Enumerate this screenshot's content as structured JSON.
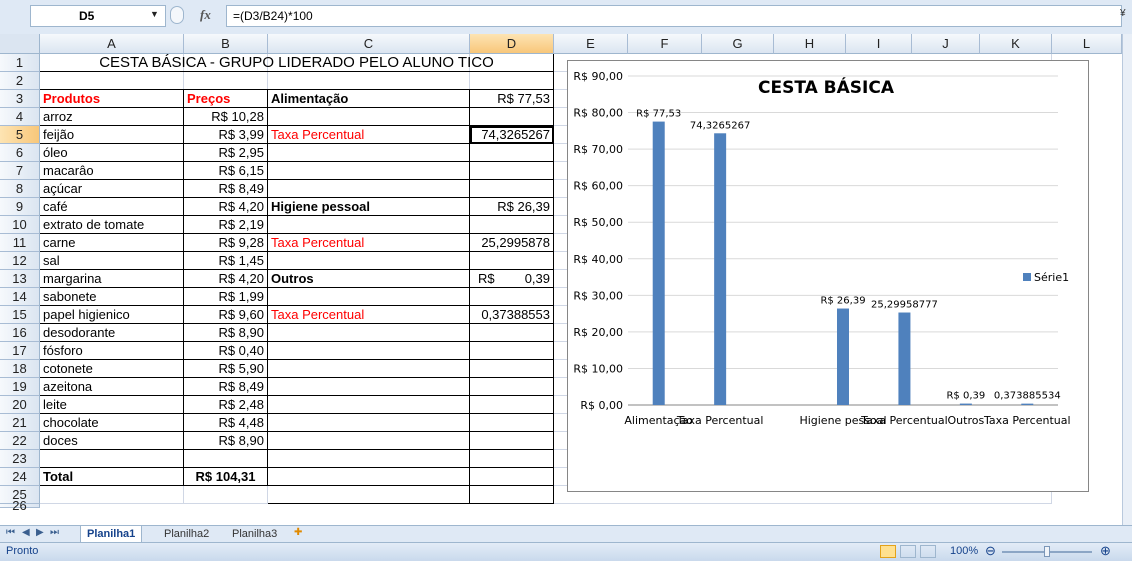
{
  "formula_bar": {
    "name_box": "D5",
    "fx": "fx",
    "formula": "=(D3/B24)*100"
  },
  "columns": [
    "A",
    "B",
    "C",
    "D",
    "E",
    "F",
    "G",
    "H",
    "I",
    "J",
    "K",
    "L"
  ],
  "rows": [
    "1",
    "2",
    "3",
    "4",
    "5",
    "6",
    "7",
    "8",
    "9",
    "10",
    "11",
    "12",
    "13",
    "14",
    "15",
    "16",
    "17",
    "18",
    "19",
    "20",
    "21",
    "22",
    "23",
    "24",
    "25",
    "26"
  ],
  "sheet": {
    "title": "CESTA BÁSICA - GRUPO LIDERADO PELO ALUNO TICO",
    "header_products": "Produtos",
    "header_prices": "Preços",
    "items": [
      {
        "name": "arroz",
        "price": "R$ 10,28"
      },
      {
        "name": "feijão",
        "price": "R$ 3,99"
      },
      {
        "name": "óleo",
        "price": "R$ 2,95"
      },
      {
        "name": "macarâo",
        "price": "R$ 6,15"
      },
      {
        "name": "açúcar",
        "price": "R$ 8,49"
      },
      {
        "name": "café",
        "price": "R$ 4,20"
      },
      {
        "name": "extrato de tomate",
        "price": "R$ 2,19"
      },
      {
        "name": "carne",
        "price": "R$ 9,28"
      },
      {
        "name": "sal",
        "price": "R$ 1,45"
      },
      {
        "name": "margarina",
        "price": "R$ 4,20"
      },
      {
        "name": "sabonete",
        "price": "R$ 1,99"
      },
      {
        "name": "papel higienico",
        "price": "R$ 9,60"
      },
      {
        "name": "desodorante",
        "price": "R$ 8,90"
      },
      {
        "name": "fósforo",
        "price": "R$ 0,40"
      },
      {
        "name": "cotonete",
        "price": "R$ 5,90"
      },
      {
        "name": "azeitona",
        "price": "R$ 8,49"
      },
      {
        "name": "leite",
        "price": "R$ 2,48"
      },
      {
        "name": "chocolate",
        "price": "R$ 4,48"
      },
      {
        "name": "doces",
        "price": "R$ 8,90"
      }
    ],
    "total_label": "Total",
    "total_value": "R$ 104,31",
    "cat_alimentacao": "Alimentação",
    "val_alimentacao": "R$ 77,53",
    "taxa_label": "Taxa Percentual",
    "taxa_alimentacao": "74,3265267",
    "cat_higiene": "Higiene  pessoal",
    "val_higiene": "R$ 26,39",
    "taxa_higiene": "25,2995878",
    "cat_outros": "Outros",
    "val_outros_currency": "R$",
    "val_outros_number": "0,39",
    "taxa_outros": "0,37388553"
  },
  "chart_data": {
    "type": "bar",
    "title": "CESTA BÁSICA",
    "categories": [
      "Alimentação",
      "Taxa Percentual",
      "",
      "Higiene  pessoal",
      "Taxa Percentual",
      "Outros",
      "Taxa Percentual"
    ],
    "series": [
      {
        "name": "Série1",
        "values": [
          77.53,
          74.3265267,
          null,
          26.39,
          25.29958777,
          0.39,
          0.373885534
        ],
        "data_labels": [
          "R$ 77,53",
          "74,3265267",
          "",
          "R$ 26,39",
          "25,29958777",
          "R$ 0,39",
          "0,373885534"
        ]
      }
    ],
    "yticks": [
      "R$ 0,00",
      "R$ 10,00",
      "R$ 20,00",
      "R$ 30,00",
      "R$ 40,00",
      "R$ 50,00",
      "R$ 60,00",
      "R$ 70,00",
      "R$ 80,00",
      "R$ 90,00"
    ],
    "ylim": [
      0,
      90
    ],
    "legend": "right",
    "color": "#4f81bd"
  },
  "tabs": [
    "Planilha1",
    "Planilha2",
    "Planilha3"
  ],
  "status": {
    "ready": "Pronto",
    "zoom": "100%"
  }
}
